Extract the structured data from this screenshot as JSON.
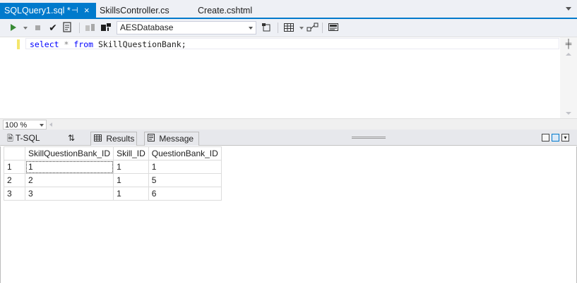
{
  "doc_tabs": {
    "active": {
      "label": "SQLQuery1.sql *",
      "pin": "⊣",
      "close": "×"
    },
    "others": [
      "SkillsController.cs",
      "Create.cshtml"
    ]
  },
  "toolbar": {
    "execute_icon": "play-icon",
    "stop_icon": "stop-icon",
    "parse_glyph": "✔",
    "database": "AESDatabase"
  },
  "editor": {
    "keyword_select": "select",
    "star": "*",
    "keyword_from": "from",
    "table": "SkillQuestionBank;"
  },
  "zoom": {
    "value": "100 %"
  },
  "results_tabs": {
    "tsql": "T-SQL",
    "swap": "⇅",
    "results": "Results",
    "message": "Message"
  },
  "grid": {
    "columns": [
      "SkillQuestionBank_ID",
      "Skill_ID",
      "QuestionBank_ID"
    ],
    "rows": [
      {
        "n": "1",
        "cells": [
          "1",
          "1",
          "1"
        ]
      },
      {
        "n": "2",
        "cells": [
          "2",
          "1",
          "5"
        ]
      },
      {
        "n": "3",
        "cells": [
          "3",
          "1",
          "6"
        ]
      }
    ]
  },
  "colors": {
    "accent": "#007acc",
    "keyword": "#0000ff",
    "toolbar_bg": "#eef0f5"
  }
}
